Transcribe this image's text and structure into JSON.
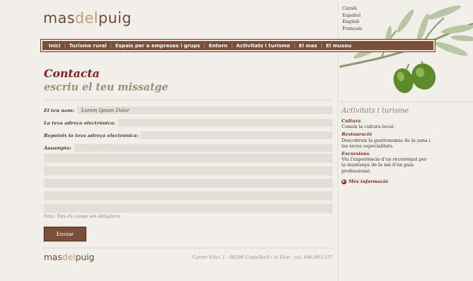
{
  "brand": {
    "logo_prefix": "mas",
    "logo_mid": "del",
    "logo_suffix": "puig"
  },
  "languages": [
    "Català",
    "Español",
    "English",
    "Français"
  ],
  "nav": [
    "Inici",
    "Turisme rural",
    "Espais per a empreses i grups",
    "Entorn",
    "Activitats i turisme",
    "El mas",
    "El museu"
  ],
  "page": {
    "title": "Contacta",
    "subtitle": "escriu el teu missatge"
  },
  "form": {
    "name_label": "El teu nom:",
    "name_value": "Lorem Ipsum Dolor",
    "email_label": "La teva adreça electrònica:",
    "email_value": "",
    "email2_label": "Repeteix la teva adreça electrònica:",
    "email2_value": "",
    "subject_label": "Assumpte:",
    "subject_value": "",
    "note": "Nota: Tots els camps són obligatoris",
    "submit": "Enviar"
  },
  "footer": {
    "address": "Carrer Vilar, 1 - 08296 Castellbell i el Vilar - tel. 606.993.557"
  },
  "sidebar": {
    "title": "Activitats i turisme",
    "items": [
      {
        "heading": "Cultura",
        "text": "Coneix la cultura local."
      },
      {
        "heading": "Restauració",
        "text": "Descobreix la gastronomia de la zona i les seves especialitats."
      },
      {
        "heading": "Excursions",
        "text": "Viu l'experiència d'un recorregut per la muntanya de la mà d'un guia professional."
      }
    ],
    "more": "Més informació"
  },
  "colors": {
    "brand_brown": "#7a4f3a",
    "accent_red": "#8c1d12",
    "background": "#f1efe9"
  }
}
